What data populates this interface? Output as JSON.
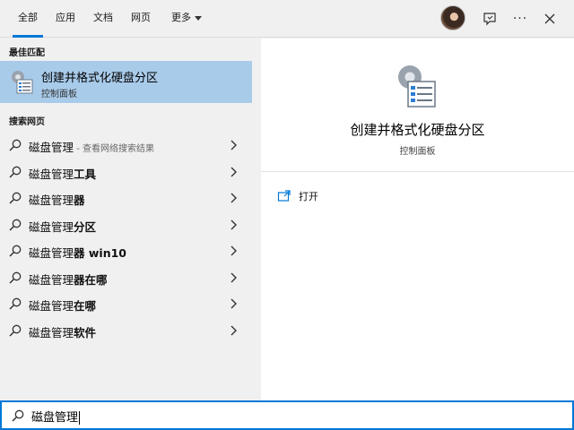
{
  "tabs": [
    {
      "label": "全部",
      "active": true
    },
    {
      "label": "应用",
      "active": false
    },
    {
      "label": "文档",
      "active": false
    },
    {
      "label": "网页",
      "active": false
    },
    {
      "label": "更多",
      "active": false
    }
  ],
  "header_icons": [
    "avatar",
    "feedback-icon",
    "more-options-icon",
    "close-icon"
  ],
  "more_options_label": "···",
  "best_match": {
    "section_title": "最佳匹配",
    "name": "创建并格式化硬盘分区",
    "subtitle": "控制面板"
  },
  "web_search": {
    "section_title": "搜索网页",
    "results": [
      {
        "prefix": "磁盘管理",
        "bold": "",
        "hint": " - 查看网络搜索结果"
      },
      {
        "prefix": "磁盘管理",
        "bold": "工具",
        "hint": ""
      },
      {
        "prefix": "磁盘管理",
        "bold": "器",
        "hint": ""
      },
      {
        "prefix": "磁盘管理",
        "bold": "分区",
        "hint": ""
      },
      {
        "prefix": "磁盘管理",
        "bold": "器 win10",
        "hint": ""
      },
      {
        "prefix": "磁盘管理",
        "bold": "器在哪",
        "hint": ""
      },
      {
        "prefix": "磁盘管理",
        "bold": "在哪",
        "hint": ""
      },
      {
        "prefix": "磁盘管理",
        "bold": "软件",
        "hint": ""
      }
    ]
  },
  "preview": {
    "title": "创建并格式化硬盘分区",
    "subtitle": "控制面板",
    "actions": [
      {
        "label": "打开",
        "icon": "open-window-icon"
      }
    ]
  },
  "search": {
    "query": "磁盘管理"
  },
  "colors": {
    "accent": "#0078d7",
    "selected_bg": "#a9cbea",
    "panel_bg": "#f0f0f0"
  }
}
